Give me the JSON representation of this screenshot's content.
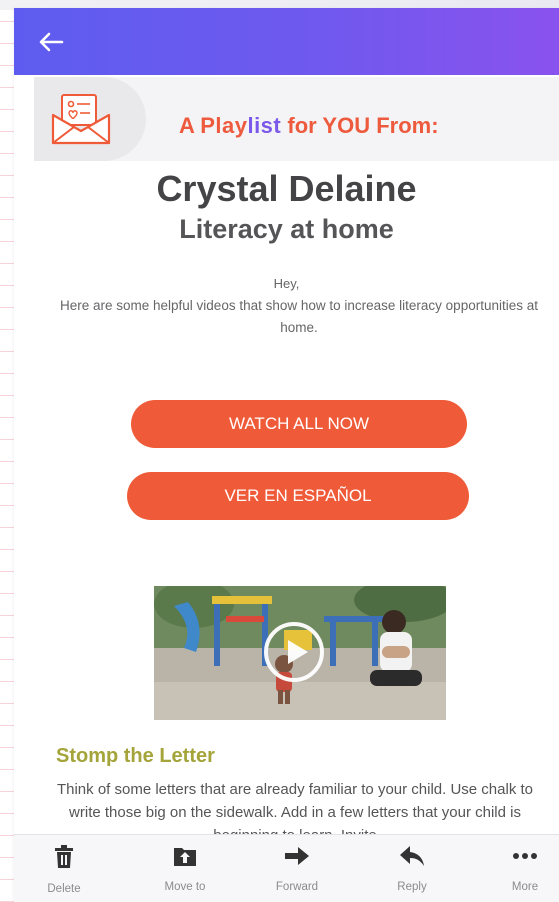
{
  "header": {
    "back_icon": "arrow-left-icon"
  },
  "banner": {
    "icon": "envelope-letter-icon",
    "prefix": "A ",
    "logo_play": "Play",
    "logo_list": "list",
    "suffix": " for YOU From:"
  },
  "playlist": {
    "author": "Crystal Delaine",
    "title": "Literacy at home",
    "greeting": "Hey,",
    "message": "Here are some helpful videos that show how to increase literacy opportunities at home."
  },
  "buttons": {
    "watch_all": "WATCH ALL NOW",
    "spanish": "VER EN ESPAÑOL"
  },
  "video": {
    "thumbnail": "playground-video-thumbnail",
    "play_icon": "play-icon"
  },
  "section": {
    "title": "Stomp the Letter",
    "text": "Think of some letters that are already familiar to your child. Use chalk to write those big on the sidewalk. Add in a few letters that your child is beginning to learn. Invite"
  },
  "toolbar": {
    "items": [
      {
        "label": "Delete",
        "icon": "trash-icon"
      },
      {
        "label": "Move to",
        "icon": "folder-move-icon"
      },
      {
        "label": "Forward",
        "icon": "forward-arrow-icon"
      },
      {
        "label": "Reply",
        "icon": "reply-arrow-icon"
      },
      {
        "label": "More",
        "icon": "more-dots-icon"
      }
    ]
  },
  "colors": {
    "appbar_start": "#5e5cf0",
    "appbar_end": "#8a52ee",
    "accent_orange": "#ef5a38",
    "section_title": "#a4a43a"
  }
}
